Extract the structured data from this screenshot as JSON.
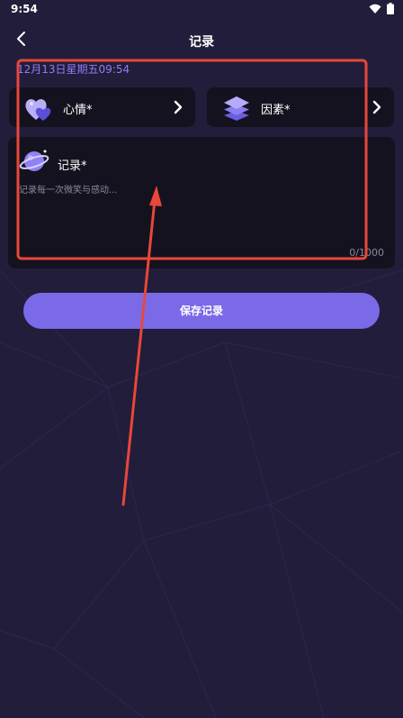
{
  "status_bar": {
    "time": "9:54"
  },
  "header": {
    "title": "记录",
    "back_icon": "chevron-left-icon"
  },
  "date_line": "12月13日星期五09:54",
  "cards": {
    "mood": {
      "label": "心情*",
      "icon": "hearts-icon"
    },
    "factor": {
      "label": "因素*",
      "icon": "layers-icon"
    }
  },
  "record": {
    "label": "记录*",
    "icon": "planet-icon",
    "placeholder": "记录每一次微笑与感动...",
    "value": "",
    "counter": "0/1000"
  },
  "save_button": {
    "label": "保存记录"
  },
  "colors": {
    "background": "#221d3a",
    "card": "#15121f",
    "accent": "#7a6ae8",
    "date_text": "#8f7cf5",
    "annotation": "#e8473a"
  }
}
